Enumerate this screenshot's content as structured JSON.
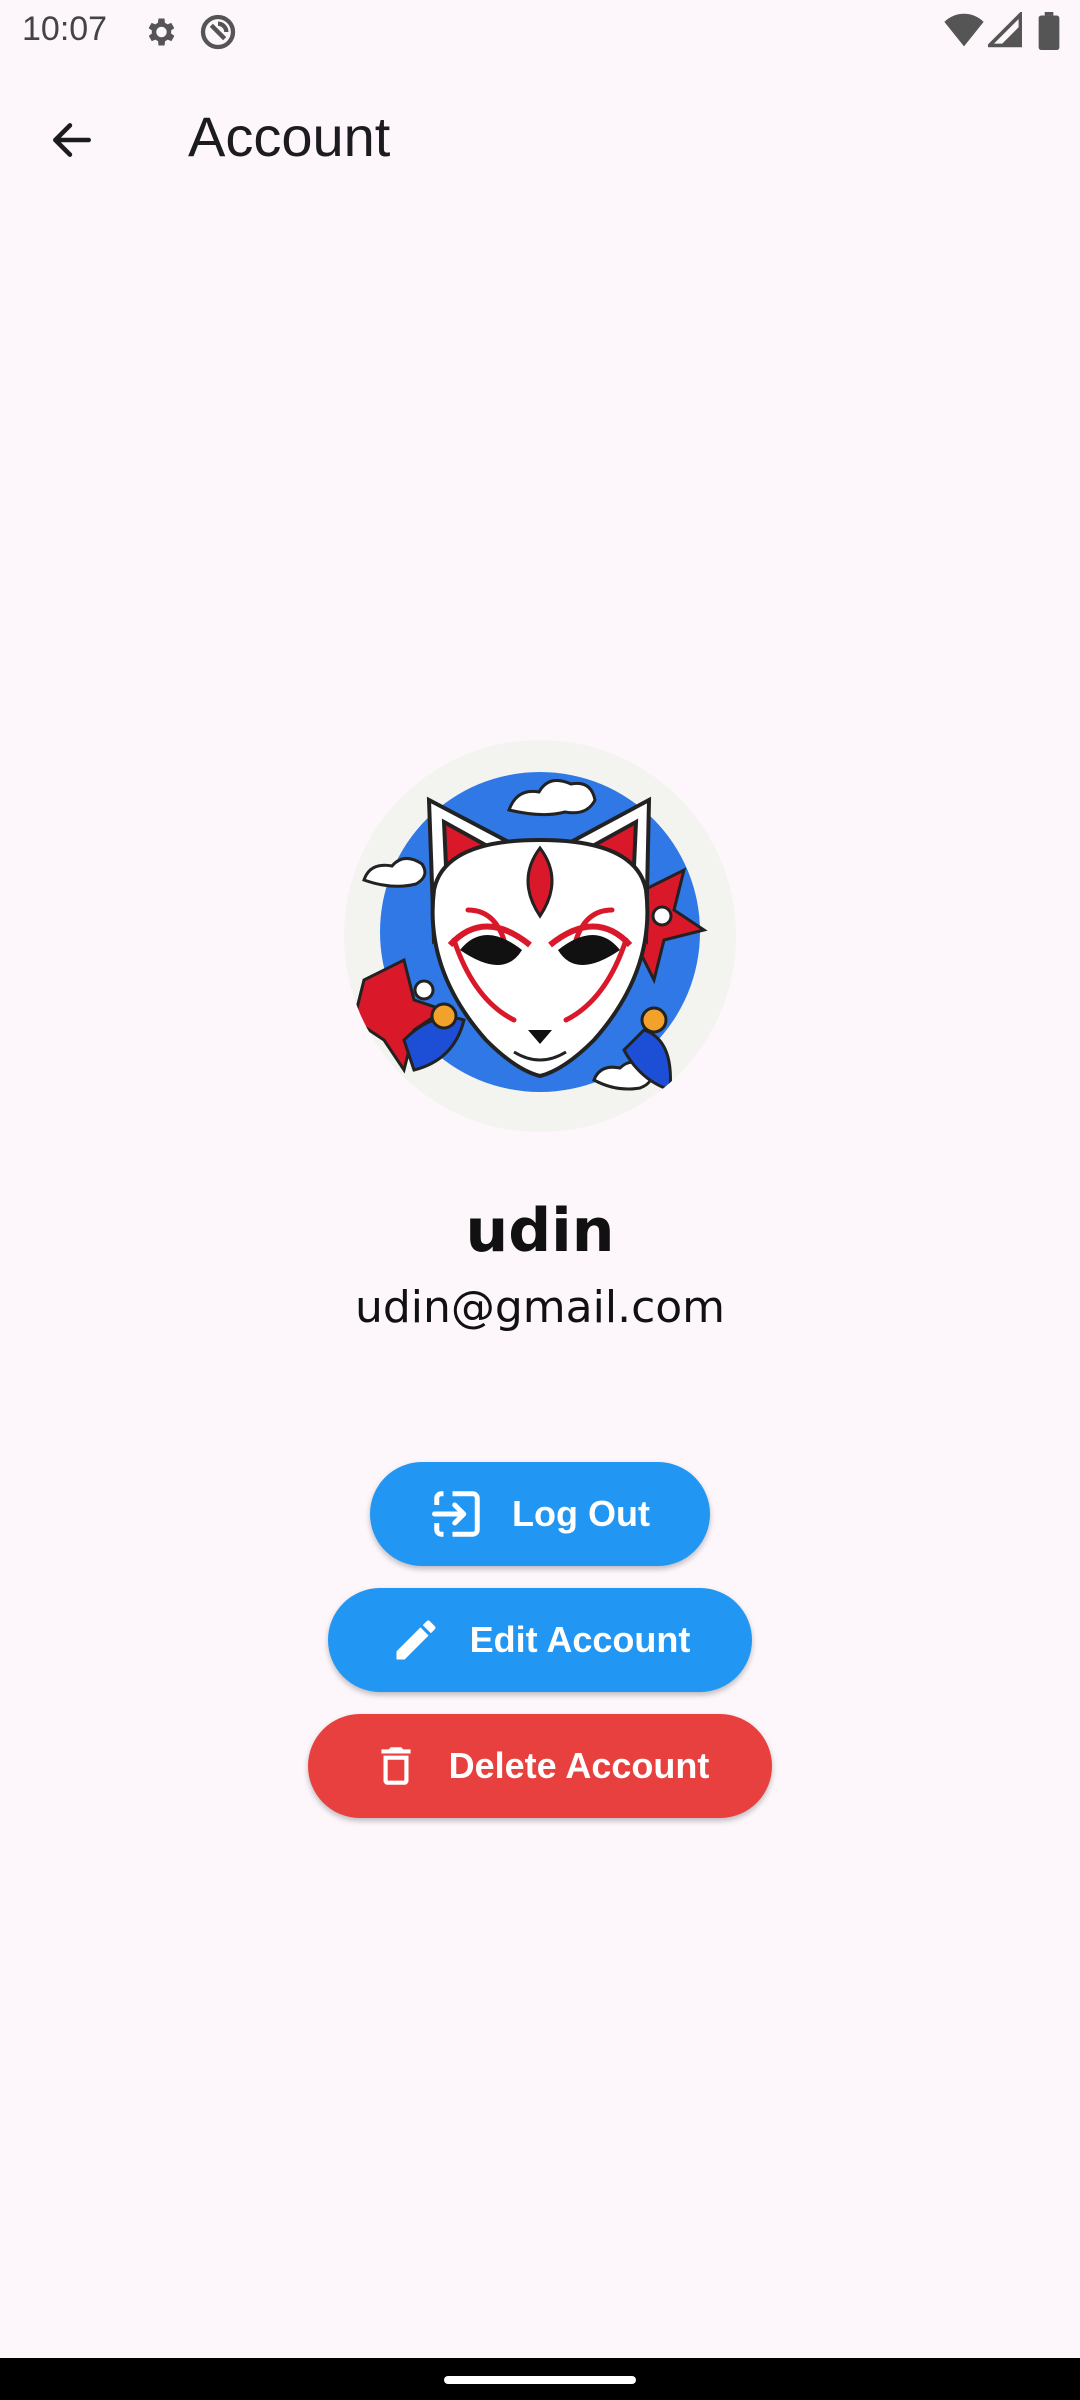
{
  "status_bar": {
    "time": "10:07",
    "icons": [
      "settings-icon",
      "vpn-icon",
      "wifi-icon",
      "signal-icon",
      "battery-icon"
    ]
  },
  "app_bar": {
    "back_icon": "arrow-back-icon",
    "title": "Account"
  },
  "profile": {
    "avatar_icon": "kitsune-mask-avatar",
    "name": "udin",
    "email": "udin@gmail.com"
  },
  "actions": {
    "logout": {
      "label": "Log Out",
      "icon": "logout-icon",
      "color": "#2196f3"
    },
    "edit": {
      "label": "Edit Account",
      "icon": "pencil-icon",
      "color": "#2196f3"
    },
    "delete": {
      "label": "Delete Account",
      "icon": "trash-icon",
      "color": "#e8403e"
    }
  },
  "colors": {
    "background": "#fdf7fb",
    "primary": "#2196f3",
    "danger": "#e8403e"
  }
}
